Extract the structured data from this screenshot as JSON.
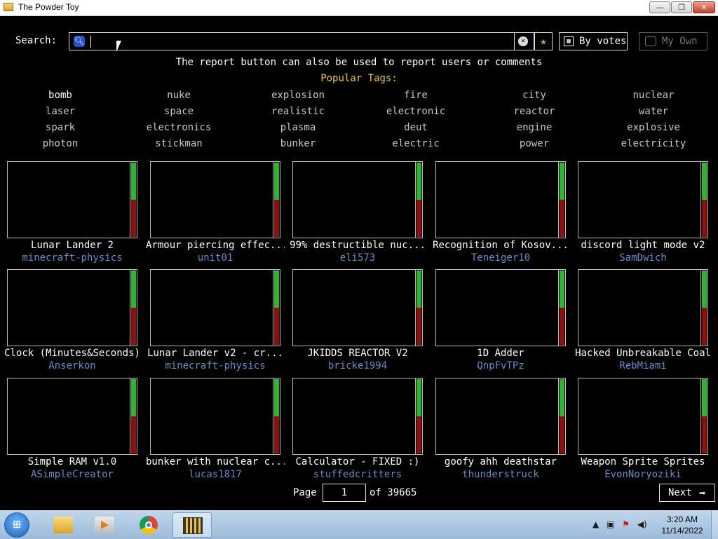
{
  "window": {
    "title": "The Powder Toy",
    "minimize": "—",
    "maximize": "❐",
    "close": "✕"
  },
  "search": {
    "label": "Search:",
    "value": "",
    "placeholder": ""
  },
  "sort_button": "By votes",
  "own_button": "My Own",
  "motd": "The report button can also be used to report users or comments",
  "popular_tags_title": "Popular Tags:",
  "tags": [
    [
      "bomb",
      "nuke",
      "explosion",
      "fire",
      "city",
      "nuclear"
    ],
    [
      "laser",
      "space",
      "realistic",
      "electronic",
      "reactor",
      "water"
    ],
    [
      "spark",
      "electronics",
      "plasma",
      "deut",
      "engine",
      "explosive"
    ],
    [
      "photon",
      "stickman",
      "bunker",
      "electric",
      "power",
      "electricity"
    ]
  ],
  "saves": [
    {
      "name": "Lunar Lander 2",
      "author": "minecraft-physics",
      "up": 0.5
    },
    {
      "name": "Armour piercing effec...",
      "author": "unit01",
      "up": 0.5
    },
    {
      "name": "99% destructible nuc...",
      "author": "eli573",
      "up": 0.5
    },
    {
      "name": "Recognition of Kosov...",
      "author": "Teneiger10",
      "up": 0.5
    },
    {
      "name": "discord light mode v2",
      "author": "SamDwich",
      "up": 0.5
    },
    {
      "name": "Clock (Minutes&Seconds)",
      "author": "Anserkon",
      "up": 0.5
    },
    {
      "name": "Lunar Lander v2 - cr...",
      "author": "minecraft-physics",
      "up": 0.5
    },
    {
      "name": "JKIDDS REACTOR V2",
      "author": "bricke1994",
      "up": 0.5
    },
    {
      "name": "1D Adder",
      "author": "QnpFvTPz",
      "up": 0.5
    },
    {
      "name": "Hacked Unbreakable Coal",
      "author": "RebMiami",
      "up": 0.5
    },
    {
      "name": "Simple RAM v1.0",
      "author": "ASimpleCreator",
      "up": 0.5
    },
    {
      "name": "bunker with nuclear c...",
      "author": "lucas1817",
      "up": 0.5
    },
    {
      "name": "Calculator - FIXED :)",
      "author": "stuffedcritters",
      "up": 0.5
    },
    {
      "name": "goofy ahh deathstar",
      "author": "thunderstruck",
      "up": 0.5
    },
    {
      "name": "Weapon Sprite Sprites",
      "author": "EvonNoryoziki",
      "up": 0.5
    }
  ],
  "pagination": {
    "label": "Page",
    "current": "1",
    "of_text": "of 39665",
    "next": "Next"
  },
  "taskbar": {
    "time": "3:20 AM",
    "date": "11/14/2022"
  },
  "colors": {
    "tag_title": "#f0c850",
    "author": "#6a8cc8",
    "vote_up": "#32b432",
    "vote_down": "#8c1010"
  }
}
